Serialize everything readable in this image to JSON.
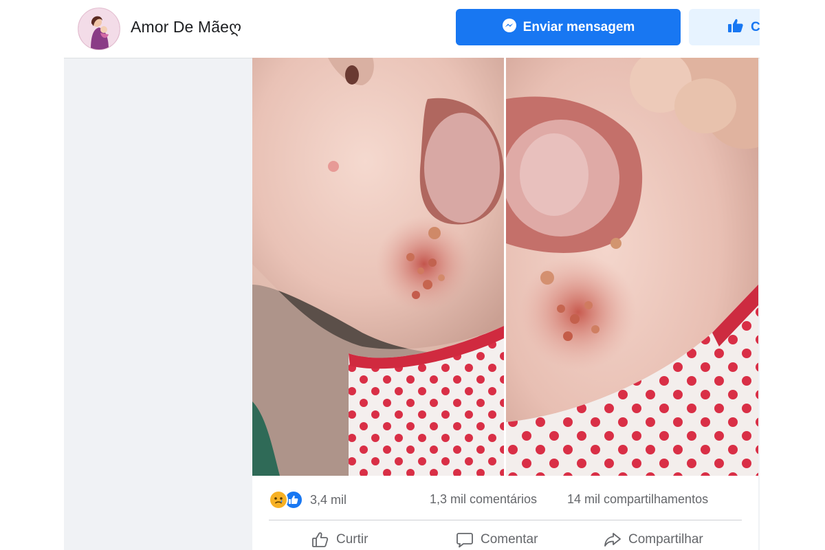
{
  "header": {
    "page_name": "Amor De Mãeღ",
    "message_button_label": "Enviar mensagem",
    "like_button_label": "C"
  },
  "post": {
    "reactions_count": "3,4 mil",
    "reaction_icons": [
      "sad-face-icon",
      "thumbs-up-icon"
    ],
    "comments_count": "1,3 mil comentários",
    "shares_count": "14 mil compartilhamentos",
    "actions": {
      "like": "Curtir",
      "comment": "Comentar",
      "share": "Compartilhar"
    }
  },
  "colors": {
    "brand_blue": "#1877f2",
    "light_blue": "#e7f3ff",
    "background": "#f0f2f5",
    "secondary_text": "#65676b"
  }
}
